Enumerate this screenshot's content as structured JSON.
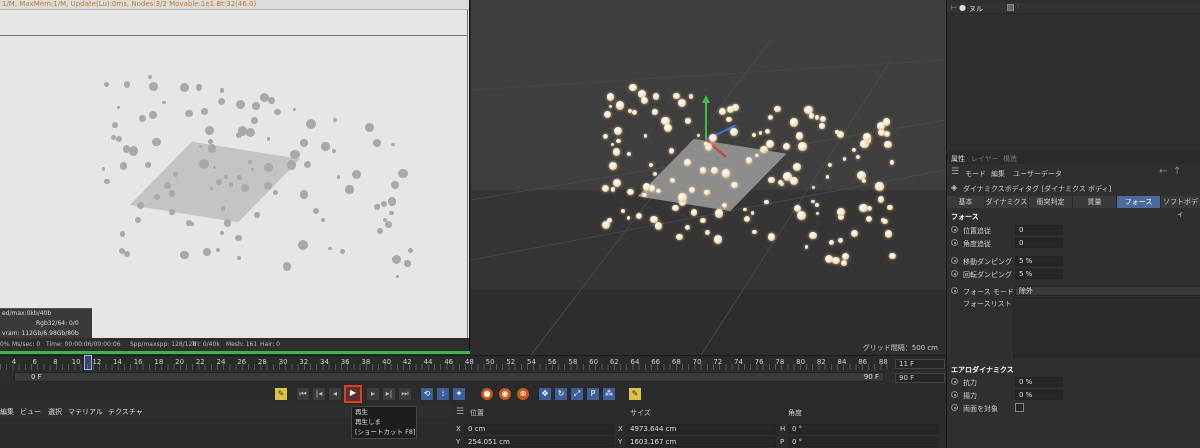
{
  "left_view": {
    "topbar_text": "1/M, MaxMem:1/M, Update(Lu):0ms, Nodes:3/2 Movable:1e1 Bt:32(46.0)",
    "stats": [
      "ed/max:0kb/40b",
      "Rgb32/64: 0/0",
      "vram: 112Gb/6.98Gb/80b"
    ],
    "bottom": {
      "ms": "Ms/sec: 0",
      "time": "Time: 00:00:06/00:00:06",
      "spp": "Spp/maxspp: 128/128",
      "tri": "Tri: 0/40k",
      "mesh": "Mesh: 161",
      "hair": "Hair: 0",
      "pct": "0%"
    }
  },
  "right_view": {
    "grid_label": "グリッド間隔：500 cm"
  },
  "object_panel": {
    "row_label": "ヌル"
  },
  "attributes": {
    "tabs": [
      "属性",
      "レイヤー",
      "構造"
    ],
    "menu": [
      "モード",
      "編集",
      "ユーザーデータ"
    ],
    "title": "ダイナミクスボディタグ [ダイナミクス ボディ]",
    "subtabs": [
      "基本",
      "ダイナミクス",
      "衝突判定",
      "質量",
      "フォース",
      "ソフトボディ"
    ],
    "active_subtab": "フォース",
    "force_heading": "フォース",
    "rows": [
      {
        "label": "位置追従",
        "value": "0"
      },
      {
        "label": "角度追従",
        "value": "0"
      },
      {
        "label": "移動ダンピング",
        "value": "5 %"
      },
      {
        "label": "回転ダンピング",
        "value": "5 %"
      }
    ],
    "force_mode_label": "フォース モード",
    "force_mode_value": "除外",
    "force_list_label": "フォースリスト",
    "aero_heading": "エアロダイナミクス",
    "aero_rows": [
      {
        "label": "抗力",
        "value": "0 %"
      },
      {
        "label": "揚力",
        "value": "0 %"
      }
    ],
    "two_sided_label": "両面を対象"
  },
  "timeline": {
    "ticks": [
      "4",
      "6",
      "8",
      "10",
      "12",
      "14",
      "16",
      "18",
      "20",
      "22",
      "24",
      "26",
      "28",
      "30",
      "32",
      "34",
      "36",
      "38",
      "40",
      "42",
      "44",
      "46",
      "48",
      "50",
      "52",
      "54",
      "56",
      "58",
      "60",
      "62",
      "64",
      "66",
      "68",
      "70",
      "72",
      "74",
      "76",
      "78",
      "80",
      "82",
      "84",
      "86",
      "88",
      "90"
    ],
    "frame_start": "0 F",
    "frame_end": "90 F",
    "current_frame": "11 F",
    "end_frame": "90 F"
  },
  "tooltip": {
    "line1": "再生",
    "line2": "再生しま",
    "line3": "[ショートカット F8]"
  },
  "bottom_menu": [
    "編集",
    "ビュー",
    "選択",
    "マテリアル",
    "テクスチャ"
  ],
  "coords": {
    "header_pos": "位置",
    "header_size": "サイズ",
    "header_rot": "角度",
    "x_label": "X",
    "x_value": "0 cm",
    "x_size": "4973.644 cm",
    "h_label": "H",
    "h_value": "0 °",
    "y_label": "Y",
    "y_value": "254.051 cm",
    "y_size": "1603.167 cm",
    "p_label": "P",
    "p_value": "0 °"
  },
  "colors": {
    "accent_blue": "#4b6a9d",
    "play_highlight": "#e04020",
    "progress_green": "#39b54a"
  }
}
